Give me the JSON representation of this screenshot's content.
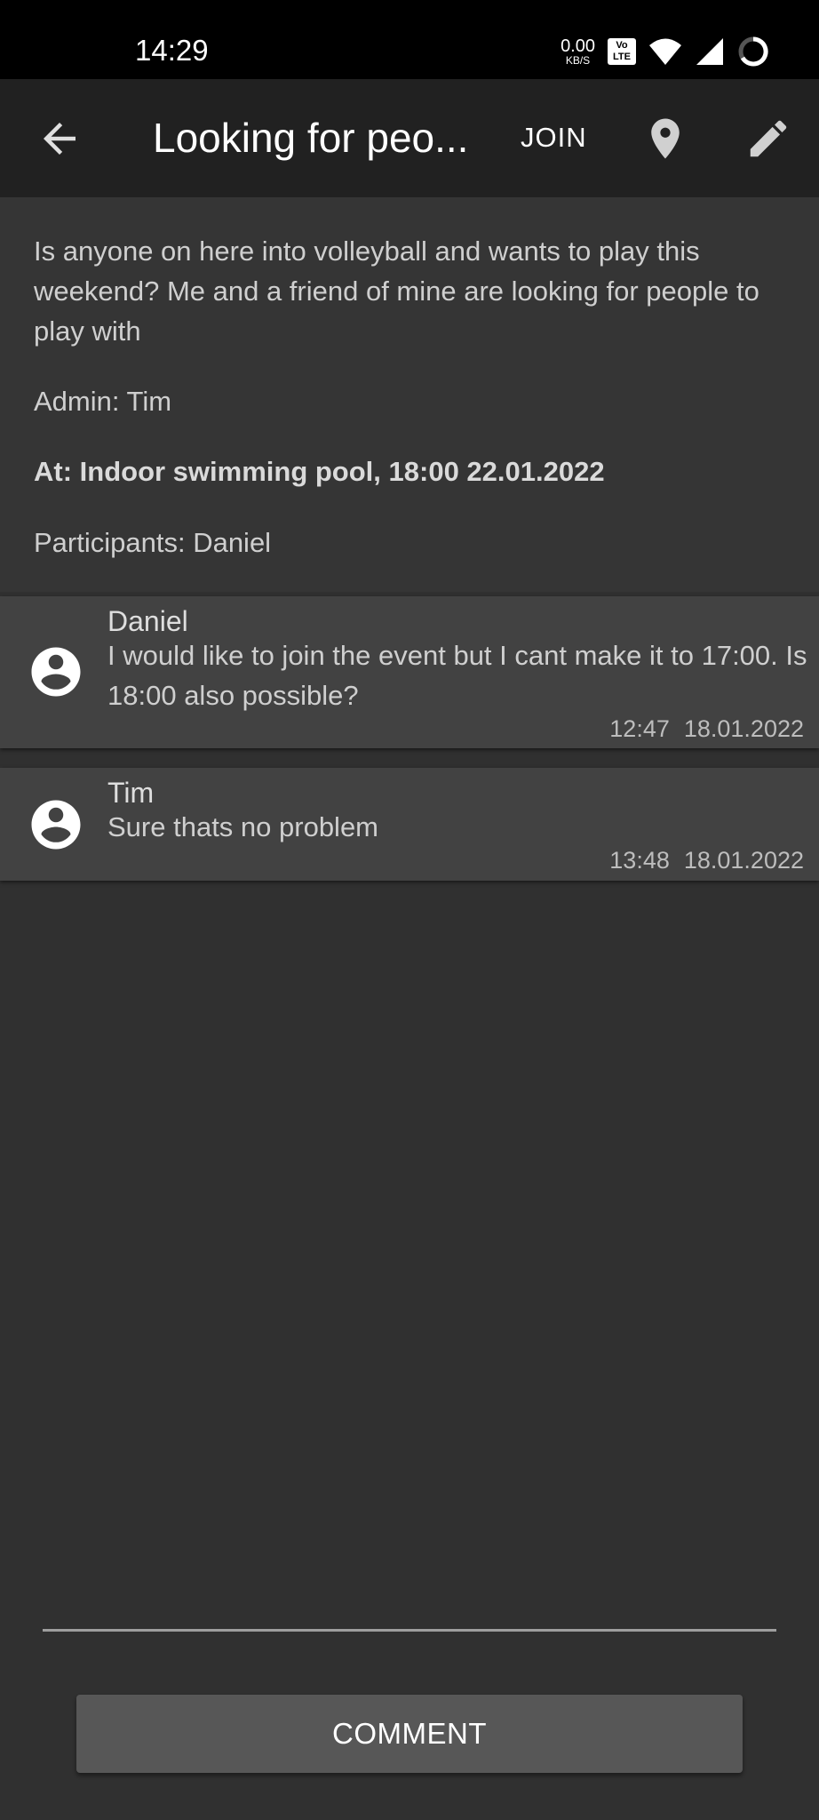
{
  "status_bar": {
    "time": "14:29",
    "net_speed_value": "0.00",
    "net_speed_unit": "KB/S",
    "volte_top": "Vo",
    "volte_bottom": "LTE",
    "icons": [
      "volte-icon",
      "wifi-icon",
      "signal-icon",
      "battery-ring-icon"
    ]
  },
  "app_bar": {
    "title": "Looking for peo...",
    "join_label": "JOIN",
    "icons": [
      "back-arrow-icon",
      "place-icon",
      "edit-icon"
    ]
  },
  "event": {
    "description": "Is anyone on here into volleyball and wants to play this weekend? Me and a friend of mine are looking for people to play with",
    "admin": "Admin: Tim",
    "location": "At: Indoor swimming pool, 18:00 22.01.2022",
    "participants": "Participants: Daniel"
  },
  "comments": [
    {
      "author": "Daniel",
      "text": "I would like to join the event but I cant make it to 17:00. Is 18:00 also possible?",
      "time": "12:47",
      "date": "18.01.2022"
    },
    {
      "author": "Tim",
      "text": "Sure thats no problem",
      "time": "13:48",
      "date": "18.01.2022"
    }
  ],
  "composer": {
    "input_value": "",
    "button_label": "COMMENT"
  },
  "colors": {
    "background": "#303030",
    "app_bar": "#212121",
    "details_panel": "#353535",
    "comment_card": "#424242",
    "button": "#575757"
  }
}
